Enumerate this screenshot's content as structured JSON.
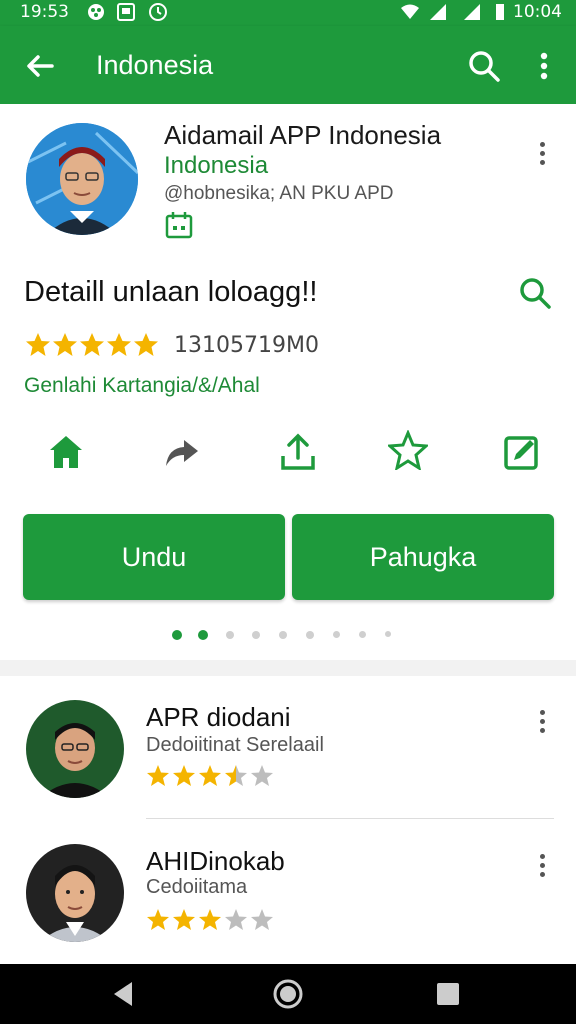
{
  "status_bar": {
    "time": "19:53",
    "clock_right": "10:04"
  },
  "app_bar": {
    "title": "Indonesia"
  },
  "app_header": {
    "title": "Aidamail APP Indonesia",
    "subtitle": "Indonesia",
    "meta": "@hobnesika; AN PKU APD"
  },
  "section": {
    "title": "Detaill unlaan loloagg!!",
    "rating_count": "13105719M0",
    "link": "Genlahi Kartangia/&/Ahal"
  },
  "buttons": {
    "primary": "Undu",
    "secondary": "Pahugka"
  },
  "list": [
    {
      "title": "APR diodani",
      "subtitle": "Dedoiitinat Serelaail",
      "rating": 3.5
    },
    {
      "title": "AHIDinokab",
      "subtitle": "Cedoiitama",
      "rating": 3
    }
  ],
  "colors": {
    "primary": "#1e9a3c",
    "accent_text": "#1e8a36",
    "star": "#f4b400",
    "star_empty": "#bdbdbd"
  },
  "icons": [
    "back-icon",
    "search-icon",
    "more-vert-icon",
    "calendar-icon",
    "home-icon",
    "share-icon",
    "upload-icon",
    "star-icon",
    "edit-icon",
    "nav-back-icon",
    "nav-home-icon",
    "nav-recents-icon"
  ]
}
